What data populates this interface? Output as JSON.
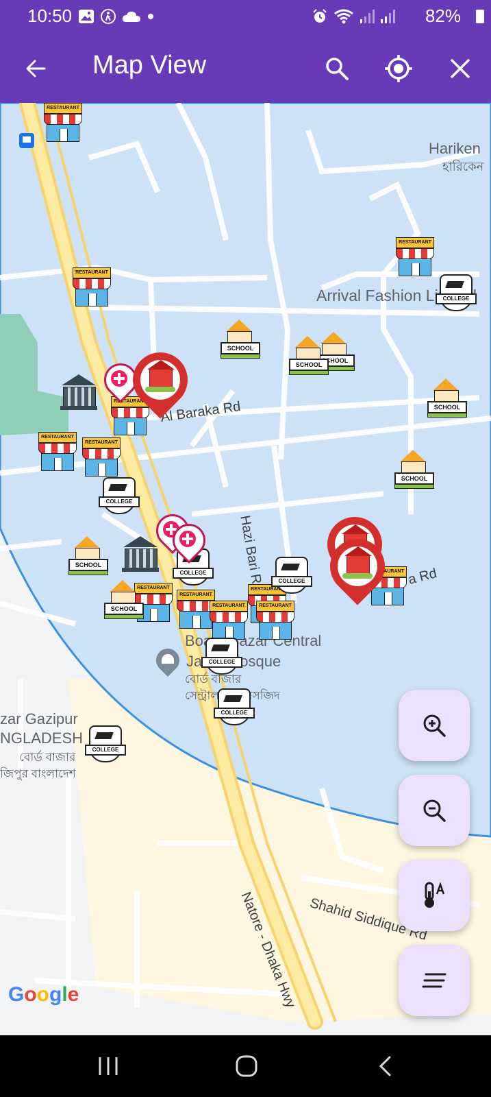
{
  "status_bar": {
    "time": "10:50",
    "battery": "82%",
    "left_icons": [
      "image-icon",
      "accessibility-icon",
      "cloud-icon",
      "dot-icon"
    ],
    "right_icons": [
      "alarm-icon",
      "wifi-icon",
      "signal-icon",
      "signal-icon"
    ]
  },
  "app_bar": {
    "title": "Map View",
    "back_icon": "arrow-back-icon",
    "actions": [
      "search-icon",
      "my-location-icon",
      "close-icon"
    ]
  },
  "map": {
    "place_labels": {
      "hariken_en": "Hariken",
      "hariken_bn": "হারিকেন",
      "arrival_fashion": "Arrival Fashion Limited",
      "mosque_en_1": "Board Bazar Central",
      "mosque_en_2": "Jame Mosque",
      "mosque_bn_1": "বোর্ড বাজার",
      "mosque_bn_2": "সেন্ট্রাল জাম মসজিদ",
      "gazipur_en_1": "zar Gazipur",
      "gazipur_en_2": "NGLADESH",
      "gazipur_bn_1": "বোর্ড বাজার",
      "gazipur_bn_2": "জিপুর বাংলাদেশ"
    },
    "road_labels": {
      "al_baraka": "Al Baraka Rd",
      "hazi_bari": "Hazi Bari Rd",
      "east_rd": "a Rd",
      "natore_dhaka": "Natore - Dhaka Hwy",
      "shahid_siddique": "Shahid Siddique Rd"
    },
    "marker_labels": {
      "restaurant": "RESTAURANT",
      "school": "SCHOOL",
      "college": "COLLEGE"
    },
    "google": {
      "G": "G",
      "o1": "o",
      "o2": "o",
      "g": "g",
      "l": "l",
      "e": "e"
    },
    "circle_color": "#3d8fe0",
    "area_color": "#cde1f7"
  },
  "fabs": [
    "zoom-in-icon",
    "zoom-out-icon",
    "temperature-icon",
    "menu-lines-icon"
  ],
  "nav_bar": [
    "recent-apps-icon",
    "home-icon",
    "back-icon"
  ]
}
